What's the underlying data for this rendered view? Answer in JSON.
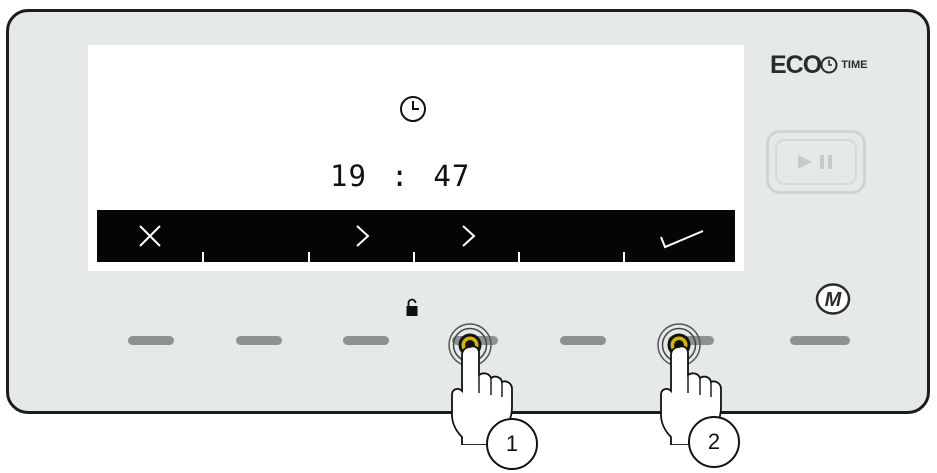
{
  "display": {
    "time_hours": "19",
    "time_separator": ":",
    "time_minutes": "47"
  },
  "softkeys": [
    {
      "icon": "close-icon",
      "symbol": "×"
    },
    {
      "icon": "none"
    },
    {
      "icon": "chevron-right-icon",
      "symbol": ">"
    },
    {
      "icon": "chevron-right-icon",
      "symbol": ">"
    },
    {
      "icon": "none"
    },
    {
      "icon": "checkmark-icon",
      "symbol": "✓"
    }
  ],
  "brand": {
    "eco": "ECO",
    "time": "TIME"
  },
  "buttons": {
    "m_label": "M"
  },
  "callouts": {
    "first": "1",
    "second": "2"
  },
  "colors": {
    "panel": "#e6e9e9",
    "softbar": "#050505",
    "key": "#8d9192",
    "press_ring": "#d6b300"
  }
}
